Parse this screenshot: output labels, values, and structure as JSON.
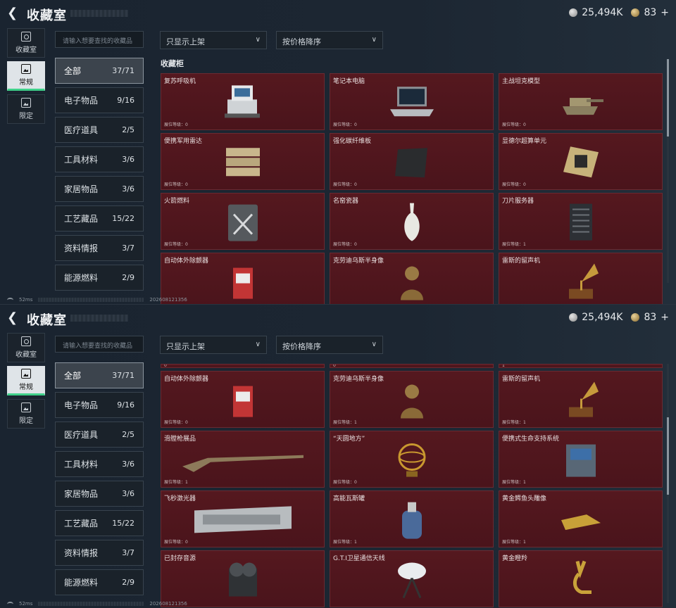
{
  "header": {
    "title": "收藏室",
    "money": "25,494K",
    "tokens": "83",
    "plus": "+"
  },
  "left_nav": [
    {
      "label": "收藏室",
      "icon": "collection-icon"
    },
    {
      "label": "常规",
      "icon": "image-icon"
    },
    {
      "label": "限定",
      "icon": "limited-image-icon"
    }
  ],
  "search": {
    "placeholder": "请输入想要查找的收藏品"
  },
  "filters": {
    "shelf": "只显示上架",
    "sort": "按价格降序"
  },
  "categories": [
    {
      "label": "全部",
      "count": "37/71"
    },
    {
      "label": "电子物品",
      "count": "9/16"
    },
    {
      "label": "医疗道具",
      "count": "2/5"
    },
    {
      "label": "工具材料",
      "count": "3/6"
    },
    {
      "label": "家居物品",
      "count": "3/6"
    },
    {
      "label": "工艺藏品",
      "count": "15/22"
    },
    {
      "label": "资料情报",
      "count": "3/7"
    },
    {
      "label": "能源燃料",
      "count": "2/9"
    }
  ],
  "cabinet_title": "收藏柜",
  "level_label": "展位等级：",
  "screen1_items": [
    {
      "name": "复苏呼吸机",
      "level": "0",
      "icon": "ventilator-icon"
    },
    {
      "name": "笔记本电脑",
      "level": "0",
      "icon": "laptop-icon"
    },
    {
      "name": "主战坦克模型",
      "level": "0",
      "icon": "tank-model-icon"
    },
    {
      "name": "便携军用雷达",
      "level": "0",
      "icon": "radar-icon"
    },
    {
      "name": "强化碳纤维板",
      "level": "0",
      "icon": "carbon-plate-icon"
    },
    {
      "name": "显德尔超算单元",
      "level": "0",
      "icon": "supercomputer-chip-icon"
    },
    {
      "name": "火箭燃料",
      "level": "0",
      "icon": "fuel-can-icon"
    },
    {
      "name": "名窑瓷器",
      "level": "0",
      "icon": "porcelain-vase-icon"
    },
    {
      "name": "刀片服务器",
      "level": "1",
      "icon": "blade-server-icon"
    },
    {
      "name": "自动体外除颤器",
      "level": "",
      "icon": "defibrillator-icon"
    },
    {
      "name": "克劳迪乌斯半身像",
      "level": "",
      "icon": "bust-icon"
    },
    {
      "name": "雷斯的留声机",
      "level": "",
      "icon": "gramophone-icon"
    }
  ],
  "screen2_top_levels": [
    "0",
    "0",
    "1"
  ],
  "screen2_items": [
    {
      "name": "自动体外除颤器",
      "level": "0",
      "icon": "defibrillator-icon"
    },
    {
      "name": "克劳迪乌斯半身像",
      "level": "1",
      "icon": "bust-icon"
    },
    {
      "name": "雷斯的留声机",
      "level": "1",
      "icon": "gramophone-icon"
    },
    {
      "name": "滑膛枪展品",
      "level": "1",
      "icon": "musket-icon"
    },
    {
      "name": "“天圆地方”",
      "level": "0",
      "icon": "armillary-sphere-icon"
    },
    {
      "name": "便携式生命支持系统",
      "level": "1",
      "icon": "life-support-icon"
    },
    {
      "name": "飞秒激光器",
      "level": "0",
      "icon": "laser-case-icon"
    },
    {
      "name": "高能瓦斯罐",
      "level": "1",
      "icon": "gas-tank-icon"
    },
    {
      "name": "黄金鳄鱼头雕像",
      "level": "1",
      "icon": "gold-croc-icon"
    },
    {
      "name": "已封存音源",
      "level": "",
      "icon": "reel-recorder-icon"
    },
    {
      "name": "G.T.I卫星通信天线",
      "level": "",
      "icon": "satellite-dish-icon"
    },
    {
      "name": "黄金瞪羚",
      "level": "",
      "icon": "gold-gazelle-icon"
    }
  ],
  "status": {
    "ping": "52ms",
    "build": "202608121356"
  }
}
